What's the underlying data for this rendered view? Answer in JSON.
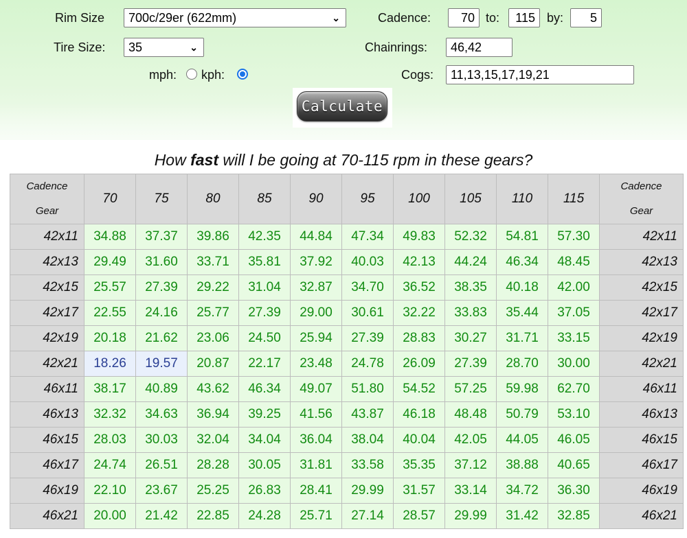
{
  "form": {
    "rim_label": "Rim Size",
    "rim_value": "700c/29er (622mm)",
    "tire_label": "Tire Size:",
    "tire_value": "35",
    "mph_label": "mph:",
    "kph_label": "kph:",
    "unit_selected": "kph",
    "cadence_label": "Cadence:",
    "cadence_from": "70",
    "to_label": "to:",
    "cadence_to": "115",
    "by_label": "by:",
    "cadence_step": "5",
    "chainrings_label": "Chainrings:",
    "chainrings_value": "46,42",
    "cogs_label": "Cogs:",
    "cogs_value": "11,13,15,17,19,21",
    "calculate_label": "Calculate"
  },
  "question": {
    "before": "How ",
    "bold": "fast",
    "after": " will I be going at 70-115 rpm in these gears?"
  },
  "table": {
    "corner_top": "Cadence",
    "corner_bottom": "Gear",
    "cadences": [
      "70",
      "75",
      "80",
      "85",
      "90",
      "95",
      "100",
      "105",
      "110",
      "115"
    ],
    "highlighted_cells": [
      [
        5,
        0
      ],
      [
        5,
        1
      ]
    ],
    "rows": [
      {
        "gear": "42x11",
        "values": [
          "34.88",
          "37.37",
          "39.86",
          "42.35",
          "44.84",
          "47.34",
          "49.83",
          "52.32",
          "54.81",
          "57.30"
        ]
      },
      {
        "gear": "42x13",
        "values": [
          "29.49",
          "31.60",
          "33.71",
          "35.81",
          "37.92",
          "40.03",
          "42.13",
          "44.24",
          "46.34",
          "48.45"
        ]
      },
      {
        "gear": "42x15",
        "values": [
          "25.57",
          "27.39",
          "29.22",
          "31.04",
          "32.87",
          "34.70",
          "36.52",
          "38.35",
          "40.18",
          "42.00"
        ]
      },
      {
        "gear": "42x17",
        "values": [
          "22.55",
          "24.16",
          "25.77",
          "27.39",
          "29.00",
          "30.61",
          "32.22",
          "33.83",
          "35.44",
          "37.05"
        ]
      },
      {
        "gear": "42x19",
        "values": [
          "20.18",
          "21.62",
          "23.06",
          "24.50",
          "25.94",
          "27.39",
          "28.83",
          "30.27",
          "31.71",
          "33.15"
        ]
      },
      {
        "gear": "42x21",
        "values": [
          "18.26",
          "19.57",
          "20.87",
          "22.17",
          "23.48",
          "24.78",
          "26.09",
          "27.39",
          "28.70",
          "30.00"
        ]
      },
      {
        "gear": "46x11",
        "values": [
          "38.17",
          "40.89",
          "43.62",
          "46.34",
          "49.07",
          "51.80",
          "54.52",
          "57.25",
          "59.98",
          "62.70"
        ]
      },
      {
        "gear": "46x13",
        "values": [
          "32.32",
          "34.63",
          "36.94",
          "39.25",
          "41.56",
          "43.87",
          "46.18",
          "48.48",
          "50.79",
          "53.10"
        ]
      },
      {
        "gear": "46x15",
        "values": [
          "28.03",
          "30.03",
          "32.04",
          "34.04",
          "36.04",
          "38.04",
          "40.04",
          "42.05",
          "44.05",
          "46.05"
        ]
      },
      {
        "gear": "46x17",
        "values": [
          "24.74",
          "26.51",
          "28.28",
          "30.05",
          "31.81",
          "33.58",
          "35.35",
          "37.12",
          "38.88",
          "40.65"
        ]
      },
      {
        "gear": "46x19",
        "values": [
          "22.10",
          "23.67",
          "25.25",
          "26.83",
          "28.41",
          "29.99",
          "31.57",
          "33.14",
          "34.72",
          "36.30"
        ]
      },
      {
        "gear": "46x21",
        "values": [
          "20.00",
          "21.42",
          "22.85",
          "24.28",
          "25.71",
          "27.14",
          "28.57",
          "29.99",
          "31.42",
          "32.85"
        ]
      }
    ]
  },
  "colors": {
    "form_bg": "#d6f5cf",
    "cell_bg": "#e8fbe3",
    "cell_text": "#128c12",
    "highlight_bg": "#e9f0fc",
    "highlight_text": "#2a3f94",
    "header_bg": "#d9d9d9",
    "radio_accent": "#1a73e8"
  }
}
